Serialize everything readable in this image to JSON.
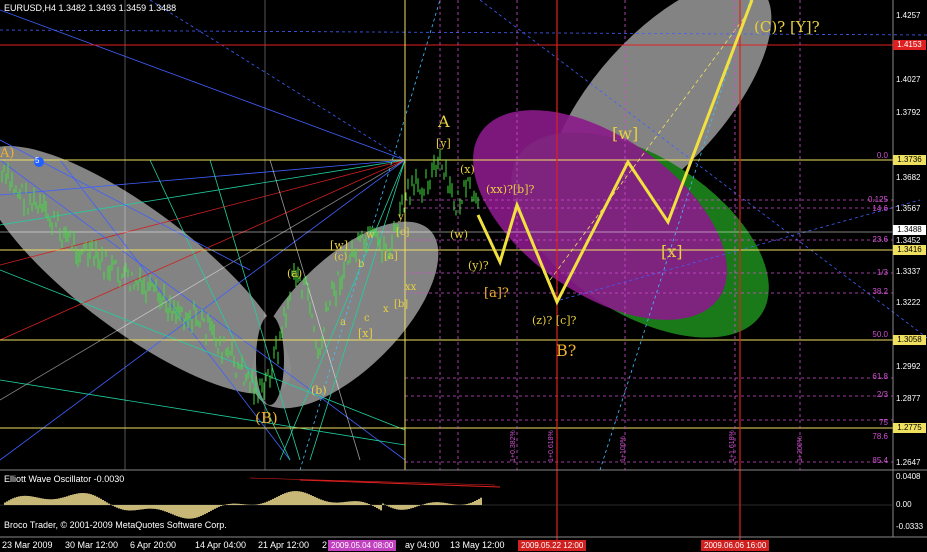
{
  "header": {
    "symbol_line": "EURUSD,H4  1.3482 1.3493 1.3459 1.3488"
  },
  "oscillator": {
    "label": "Elliott Wave Oscillator -0.0030",
    "scale": [
      "0.0408",
      "0.00",
      "-0.0333"
    ]
  },
  "copyright": "Broco Trader, © 2001-2009 MetaQuotes Software Corp.",
  "price_scale": [
    "1.4257",
    "1.4027",
    "1.3792",
    "1.3682",
    "1.3567",
    "1.3452",
    "1.3337",
    "1.3222",
    "1.2992",
    "1.2877",
    "1.2647"
  ],
  "price_boxes": [
    {
      "text": "1.4153",
      "bg": "#e02020",
      "fg": "#ffffff"
    },
    {
      "text": "1.3736",
      "bg": "#f0e060",
      "fg": "#000000"
    },
    {
      "text": "1.3488",
      "bg": "#ffffff",
      "fg": "#000000"
    },
    {
      "text": "1.3416",
      "bg": "#f0e060",
      "fg": "#000000"
    },
    {
      "text": "1.3058",
      "bg": "#f0e060",
      "fg": "#000000"
    },
    {
      "text": "1.2775",
      "bg": "#f0e060",
      "fg": "#000000"
    }
  ],
  "fib_levels": [
    "0.0",
    "0.125",
    "14.6",
    "23.6",
    "1/3",
    "38.2",
    "50.0",
    "61.8",
    "2/3",
    "75",
    "78.6",
    "85.4"
  ],
  "time_scale": [
    "23 Mar 2009",
    "30 Mar 12:00",
    "6 Apr 20:00",
    "14 Apr 04:00",
    "21 Apr 12:00",
    "2",
    "ay 04:00",
    "13 May 12:00"
  ],
  "time_boxes": [
    {
      "text": "2009.05.04 08:00",
      "bg": "#c040c0"
    },
    {
      "text": "2009.05.22 12:00",
      "bg": "#d02020"
    },
    {
      "text": "2009.06.06 16:00",
      "bg": "#d02020"
    }
  ],
  "vertical_labels": [
    "1+0.382%",
    "1+0.618%",
    "1+100%",
    "1+1.618%",
    "1+200%"
  ],
  "wave_labels": {
    "cy": "(C)? [Y]?",
    "a_big": "A",
    "y_br": "[y]",
    "w_br_big": "[w]",
    "x_paren": "(x)",
    "xx_b": "(xx)?[b]?",
    "w_paren": "(w)",
    "y_paren": "(y)?",
    "a_br": "[a]?",
    "z_c": "(z)? [c]?",
    "b_big": "B?",
    "x_br_big": "[x]",
    "a_paren": "(a)",
    "b_paren": "(b)",
    "B_paren": "(B)",
    "w_br": "[w]",
    "c_paren": "(c)",
    "a_small": "a",
    "b_small": "b",
    "c_small": "c",
    "w_small": "w",
    "x_br": "[x]",
    "a_br2": "[a]",
    "c_br": "[c]",
    "y_small": "y",
    "x_small": "x",
    "b_br": "[b]",
    "xx_small": "xx",
    "a_left": "A)",
    "five": "5"
  }
}
